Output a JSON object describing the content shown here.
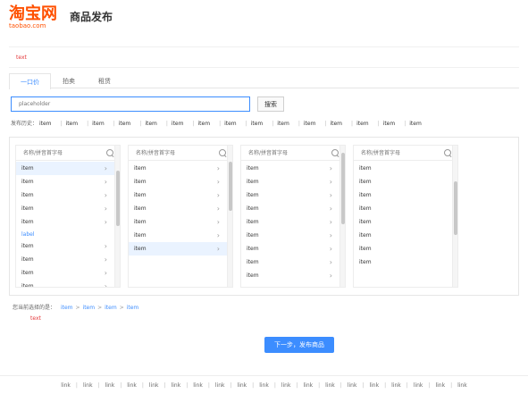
{
  "header": {
    "brand": "淘宝网",
    "brand_domain": "taobao.com",
    "page_title": "商品发布",
    "brand_color": "#ff5000"
  },
  "notice": {
    "text": "text"
  },
  "tabs": [
    {
      "label": "一口价"
    },
    {
      "label": "拍卖"
    },
    {
      "label": "租赁"
    }
  ],
  "search": {
    "placeholder": "placeholder",
    "button_label": "搜索"
  },
  "history": {
    "label": "发布历史：",
    "items": [
      "item",
      "item",
      "item",
      "item",
      "item",
      "item",
      "item",
      "item",
      "item",
      "item",
      "item",
      "item",
      "item",
      "item",
      "item"
    ]
  },
  "columns": [
    {
      "search_placeholder": "名称/拼音首字母",
      "items": [
        "item",
        "item",
        "item",
        "item",
        "item"
      ],
      "section_label": "label",
      "items_after_section": [
        "item",
        "item",
        "item",
        "item"
      ],
      "selected_index": 0
    },
    {
      "search_placeholder": "名称/拼音首字母",
      "items": [
        "item",
        "item",
        "item",
        "item",
        "item",
        "item",
        "item"
      ],
      "selected_index": 6
    },
    {
      "search_placeholder": "名称/拼音首字母",
      "items": [
        "item",
        "item",
        "item",
        "item",
        "item",
        "item",
        "item",
        "item",
        "item"
      ],
      "selected_index": -1
    },
    {
      "search_placeholder": "名称/拼音首字母",
      "items": [
        "item",
        "item",
        "item",
        "item",
        "item",
        "item",
        "item",
        "item"
      ],
      "selected_index": -1
    }
  ],
  "selected_path": {
    "label": "您当前选择的是：",
    "path": [
      "item",
      "item",
      "item",
      "item"
    ]
  },
  "warning": {
    "text": "text"
  },
  "next_button": {
    "label": "下一步，发布商品"
  },
  "footer": {
    "links": [
      "link",
      "link",
      "link",
      "link",
      "link",
      "link",
      "link",
      "link",
      "link",
      "link",
      "link",
      "link",
      "link",
      "link",
      "link",
      "link",
      "link",
      "link",
      "link"
    ]
  },
  "colors": {
    "accent": "#3c8dff",
    "warning": "#e4393c",
    "brand": "#ff5000"
  }
}
